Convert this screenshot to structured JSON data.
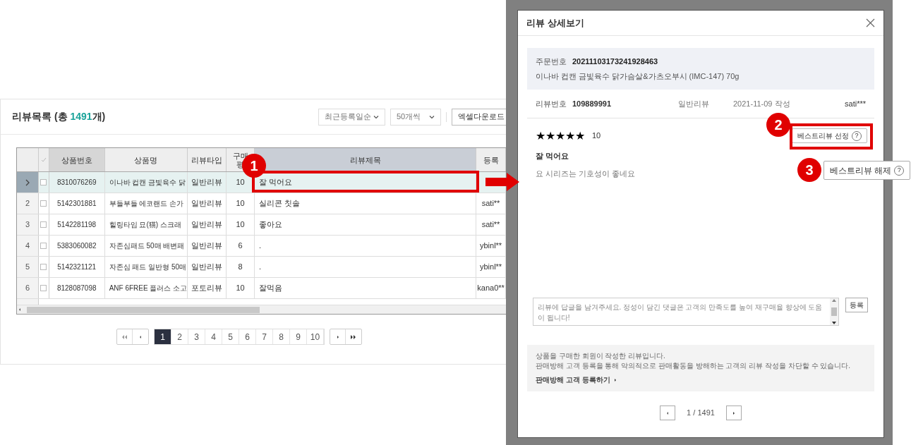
{
  "list": {
    "title_prefix": "리뷰목록 (총 ",
    "total": "1491",
    "title_suffix": "개)",
    "sort": "최근등록일순",
    "per_page": "50개씩",
    "excel": "엑셀다운로드",
    "columns": [
      "상품번호",
      "상품명",
      "리뷰타입",
      "구매 평",
      "리뷰제목",
      "등록"
    ],
    "rows": [
      {
        "selected": true,
        "checked": false,
        "num": "",
        "product_no": "8310076269",
        "product": "이나바 컵캔 금빛육수 닭",
        "type": "일반리뷰",
        "score": "10",
        "title": "잘 먹어요",
        "writer": ""
      },
      {
        "selected": false,
        "checked": false,
        "num": "2",
        "product_no": "5142301881",
        "product": "부들부들 에코랜드 손가",
        "type": "일반리뷰",
        "score": "10",
        "title": "실리콘 칫솔",
        "writer": "sati**"
      },
      {
        "selected": false,
        "checked": false,
        "num": "3",
        "product_no": "5142281198",
        "product": "힐링타임 묘(猫) 스크래",
        "type": "일반리뷰",
        "score": "10",
        "title": "좋아요",
        "writer": "sati**"
      },
      {
        "selected": false,
        "checked": false,
        "num": "4",
        "product_no": "5383060082",
        "product": "자존심패드 50매 배변패",
        "type": "일반리뷰",
        "score": "6",
        "title": ".",
        "writer": "ybinl**"
      },
      {
        "selected": false,
        "checked": false,
        "num": "5",
        "product_no": "5142321121",
        "product": "자존심 패드 일반형 50매",
        "type": "일반리뷰",
        "score": "8",
        "title": ".",
        "writer": "ybinl**"
      },
      {
        "selected": false,
        "checked": false,
        "num": "6",
        "product_no": "8128087098",
        "product": "ANF 6FREE 플러스 소고",
        "type": "포토리뷰",
        "score": "10",
        "title": "잘먹음",
        "writer": "kana0**"
      }
    ],
    "pages": [
      {
        "label": "1",
        "selected": true
      },
      {
        "label": "2",
        "selected": false
      },
      {
        "label": "3",
        "selected": false
      },
      {
        "label": "4",
        "selected": false
      },
      {
        "label": "5",
        "selected": false
      },
      {
        "label": "6",
        "selected": false
      },
      {
        "label": "7",
        "selected": false
      },
      {
        "label": "8",
        "selected": false
      },
      {
        "label": "9",
        "selected": false
      },
      {
        "label": "10",
        "selected": false
      }
    ]
  },
  "modal": {
    "title": "리뷰 상세보기",
    "order_label": "주문번호",
    "order_no": "20211103173241928463",
    "product": "이나바 컵캔 금빛육수 닭가슴살&가츠오부시 (IMC-147) 70g",
    "review_label": "리뷰번호",
    "review_no": "109889991",
    "review_type": "일반리뷰",
    "date": "2021-11-09 작성",
    "writer": "sati***",
    "stars": 5,
    "score": "10",
    "best_select": "베스트리뷰 선정",
    "review_title": "잘 먹어요",
    "review_body": "요 시리즈는 기호성이 좋네요",
    "reply": {
      "placeholder": "리뷰에 답글을 남겨주세요. 정성이 담긴 댓글은 고객의 만족도를 높여 재구매율 향상에 도움이 됩니다!"
    },
    "submit": "등록",
    "notice": [
      "상품을 구매한 회원이 작성한 리뷰입니다.",
      "판매방해 고객 등록을 통해 악의적으로 판매활동을 방해하는 고객의 리뷰 작성을 차단할 수 있습니다."
    ],
    "notice_link": "판매방해 고객 등록하기",
    "pager": "1 / 1491"
  },
  "annotations": {
    "markers": [
      "1",
      "2",
      "3"
    ],
    "best_release": "베스트리뷰 해제",
    "help": "?"
  }
}
